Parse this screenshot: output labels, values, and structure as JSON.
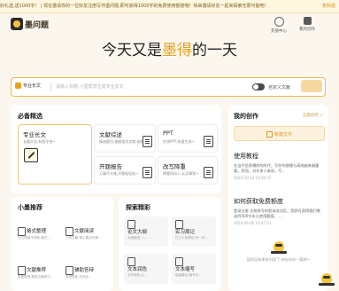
{
  "banner": {
    "text": "好礼送,送1000字！ | 现在邀请你的一位好友注册写作墨问题,即可获得1000字的免费使用额度哦！快来邀请好友一起来探索无限可能吧！",
    "link": "复制邀"
  },
  "header": {
    "logo_text": "墨问题",
    "actions": [
      {
        "label": "充值中心",
        "icon": "yuan-icon"
      },
      {
        "label": "我的创作",
        "icon": "user-icon"
      }
    ]
  },
  "hero": {
    "prefix": "今天又是",
    "accent": "墨得",
    "suffix": "的一天"
  },
  "search": {
    "type_label": "专业长文",
    "placeholder": "请输入标题,小墨帮您生成专业长文",
    "toggle_label": "自定义文献",
    "button": ""
  },
  "featured": {
    "title": "必备精选",
    "tools": [
      {
        "title": "专业长文",
        "desc": "长篇文化,有我不怕~"
      },
      {
        "title": "文献综述",
        "desc": "精选题目,根据相关文献,助综述"
      },
      {
        "title": "PPT",
        "desc": "在线PPT,快速生成~"
      },
      {
        "title": "开题报告",
        "desc": "万事开头难,开题轻轻松~"
      },
      {
        "title": "改写降重",
        "desc": "降重再向人,从文章到~"
      }
    ]
  },
  "recommend": {
    "title": "小墨推荐",
    "items": [
      {
        "title": "格式整理",
        "desc": "论文排版不用愁,格式..."
      },
      {
        "title": "文献阅读",
        "desc": "上传文献,核心要点完美..."
      },
      {
        "title": "文献推荐",
        "desc": "智能推荐,精准文献助力..."
      },
      {
        "title": "辅助答辩",
        "desc": "答辩轻松,无忧无..."
      }
    ]
  },
  "explore": {
    "title": "探索精彩",
    "items": [
      {
        "title": "论文大纲",
        "desc": "大纲速成,一..."
      },
      {
        "title": "实习周记",
        "desc": "打工人的周记,写一写..."
      },
      {
        "title": "文本润色",
        "desc": "文字润色,让..."
      },
      {
        "title": "文本缩写",
        "desc": "保留要点,缩写无..."
      }
    ]
  },
  "creations": {
    "title": "我的创作",
    "more_link": "全部创作 >",
    "new_button": "新建文件",
    "works": [
      {
        "title": "使用教程",
        "desc": "在当今信息爆炸的时代，写作的便捷与高效越来越重要。然而，对许多人来说，写...",
        "time": "2024-10-14 10:56:37"
      },
      {
        "title": "如何获取免费额度",
        "desc": "登录注册 注册账号的登录成功后，您即可获得我们赠送的500字永久使用额度。...",
        "time": "2024-06-06 10:47:21"
      }
    ],
    "footer": "暂时没有更多内容了,快去创作一篇吧~"
  }
}
